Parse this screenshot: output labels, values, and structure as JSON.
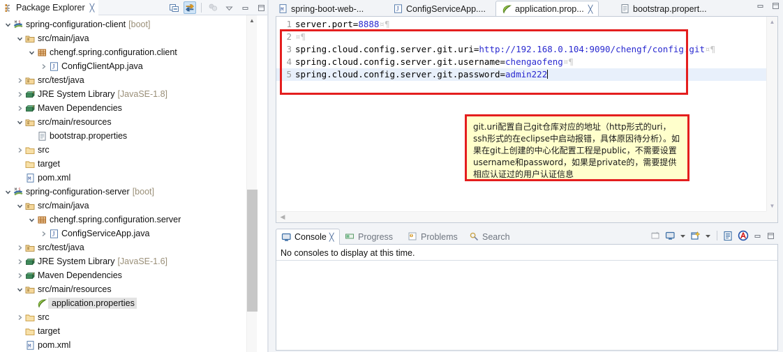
{
  "package_explorer": {
    "tab_label": "Package Explorer",
    "tab_close": "╳",
    "toolbar": {
      "collapse_all": "collapse-all-icon",
      "link_with_editor": "link-with-editor-icon",
      "focus_on_active_task": "focus-task-icon",
      "view_menu": "view-menu-icon",
      "minimize": "minimize-icon",
      "maximize": "maximize-icon"
    },
    "tree": [
      {
        "depth": 0,
        "arrow": "down",
        "icon": "project-boot-icon",
        "label": "spring-configuration-client",
        "sub": "[boot]",
        "selected": false
      },
      {
        "depth": 1,
        "arrow": "down",
        "icon": "source-folder-icon",
        "label": "src/main/java",
        "sub": "",
        "selected": false
      },
      {
        "depth": 2,
        "arrow": "down",
        "icon": "package-icon",
        "label": "chengf.spring.configuration.client",
        "sub": "",
        "selected": false
      },
      {
        "depth": 3,
        "arrow": "right",
        "icon": "java-file-icon",
        "label": "ConfigClientApp.java",
        "sub": "",
        "selected": false
      },
      {
        "depth": 1,
        "arrow": "right",
        "icon": "source-folder-icon",
        "label": "src/test/java",
        "sub": "",
        "selected": false
      },
      {
        "depth": 1,
        "arrow": "right",
        "icon": "library-icon",
        "label": "JRE System Library",
        "sub": "[JavaSE-1.8]",
        "selected": false
      },
      {
        "depth": 1,
        "arrow": "right",
        "icon": "library-icon",
        "label": "Maven Dependencies",
        "sub": "",
        "selected": false
      },
      {
        "depth": 1,
        "arrow": "down",
        "icon": "source-folder-icon",
        "label": "src/main/resources",
        "sub": "",
        "selected": false
      },
      {
        "depth": 2,
        "arrow": "none",
        "icon": "file-icon",
        "label": "bootstrap.properties",
        "sub": "",
        "selected": false
      },
      {
        "depth": 1,
        "arrow": "right",
        "icon": "folder-icon",
        "label": "src",
        "sub": "",
        "selected": false
      },
      {
        "depth": 1,
        "arrow": "none",
        "icon": "folder-icon",
        "label": "target",
        "sub": "",
        "selected": false
      },
      {
        "depth": 1,
        "arrow": "none",
        "icon": "maven-pom-icon",
        "label": "pom.xml",
        "sub": "",
        "selected": false
      },
      {
        "depth": 0,
        "arrow": "down",
        "icon": "project-boot-icon",
        "label": "spring-configuration-server",
        "sub": "[boot]",
        "selected": false
      },
      {
        "depth": 1,
        "arrow": "down",
        "icon": "source-folder-icon",
        "label": "src/main/java",
        "sub": "",
        "selected": false
      },
      {
        "depth": 2,
        "arrow": "down",
        "icon": "package-icon",
        "label": "chengf.spring.configuration.server",
        "sub": "",
        "selected": false
      },
      {
        "depth": 3,
        "arrow": "right",
        "icon": "java-file-icon",
        "label": "ConfigServiceApp.java",
        "sub": "",
        "selected": false
      },
      {
        "depth": 1,
        "arrow": "right",
        "icon": "source-folder-icon",
        "label": "src/test/java",
        "sub": "",
        "selected": false
      },
      {
        "depth": 1,
        "arrow": "right",
        "icon": "library-icon",
        "label": "JRE System Library",
        "sub": "[JavaSE-1.6]",
        "selected": false
      },
      {
        "depth": 1,
        "arrow": "right",
        "icon": "library-icon",
        "label": "Maven Dependencies",
        "sub": "",
        "selected": false
      },
      {
        "depth": 1,
        "arrow": "down",
        "icon": "source-folder-icon",
        "label": "src/main/resources",
        "sub": "",
        "selected": false
      },
      {
        "depth": 2,
        "arrow": "none",
        "icon": "properties-leaf-icon",
        "label": "application.properties",
        "sub": "",
        "selected": true
      },
      {
        "depth": 1,
        "arrow": "right",
        "icon": "folder-icon",
        "label": "src",
        "sub": "",
        "selected": false
      },
      {
        "depth": 1,
        "arrow": "none",
        "icon": "folder-icon",
        "label": "target",
        "sub": "",
        "selected": false
      },
      {
        "depth": 1,
        "arrow": "none",
        "icon": "maven-pom-icon",
        "label": "pom.xml",
        "sub": "",
        "selected": false
      }
    ]
  },
  "editor": {
    "tabs": [
      {
        "label": "spring-boot-web-...",
        "icon": "maven-pom-icon",
        "active": false,
        "closable": false
      },
      {
        "label": "ConfigServiceApp....",
        "icon": "java-file-icon",
        "active": false,
        "closable": false
      },
      {
        "label": "application.prop...",
        "icon": "properties-leaf-icon",
        "active": true,
        "closable": true
      },
      {
        "label": "bootstrap.propert...",
        "icon": "file-icon",
        "active": false,
        "closable": false
      }
    ],
    "tab_close_glyph": "╳",
    "controls": {
      "minimize": "minimize-icon",
      "maximize": "maximize-icon"
    },
    "lines": [
      {
        "no": "1",
        "key": "server.port=",
        "value": "8888",
        "eol": "¤¶",
        "current": false
      },
      {
        "no": "2",
        "key": "",
        "value": "",
        "eol": "¤¶",
        "current": false
      },
      {
        "no": "3",
        "key": "spring.cloud.config.server.git.uri=",
        "value": "http://192.168.0.104:9090/chengf/config.git",
        "eol": "¤¶",
        "current": false
      },
      {
        "no": "4",
        "key": "spring.cloud.config.server.git.username=",
        "value": "chengaofeng",
        "eol": "¤¶",
        "current": false
      },
      {
        "no": "5",
        "key": "spring.cloud.config.server.git.password=",
        "value": "admin222",
        "eol": "",
        "current": true
      }
    ],
    "scroll": {
      "up": "scroll-up-arrow",
      "down": "scroll-down-arrow",
      "left": "scroll-left-arrow"
    }
  },
  "note": {
    "text": "git.uri配置自己git仓库对应的地址（http形式的uri，ssh形式的在eclipse中启动报错，具体原因待分析）。如果在git上创建的中心化配置工程是public，不需要设置username和password，如果是private的，需要提供相应认证过的用户认证信息",
    "border_color": "#e41e1e",
    "background_color": "#ffffcc"
  },
  "console": {
    "tabs": [
      {
        "label": "Console",
        "icon": "console-icon",
        "active": true,
        "closable": true
      },
      {
        "label": "Progress",
        "icon": "progress-icon",
        "active": false,
        "closable": false
      },
      {
        "label": "Problems",
        "icon": "problems-icon",
        "active": false,
        "closable": false
      },
      {
        "label": "Search",
        "icon": "search-icon",
        "active": false,
        "closable": false
      }
    ],
    "tab_close_glyph": "╳",
    "message": "No consoles to display at this time.",
    "toolbar": {
      "pin_console": "pin-console-icon",
      "display_selected_console": "display-console-icon",
      "display_dropdown": "chevron-down-icon",
      "open_console": "new-console-icon",
      "open_dropdown": "chevron-down-icon",
      "word_wrap": "word-wrap-icon",
      "ansi_console": "ansi-console-icon",
      "minimize": "minimize-icon",
      "maximize": "maximize-icon"
    }
  },
  "colors": {
    "highlight_red": "#e41e1e",
    "code_value_blue": "#2a2ad0",
    "current_line": "#e8f0fb",
    "selection_gray": "#e3e3e3",
    "link_active_toolbar": "#cfe4f7"
  }
}
